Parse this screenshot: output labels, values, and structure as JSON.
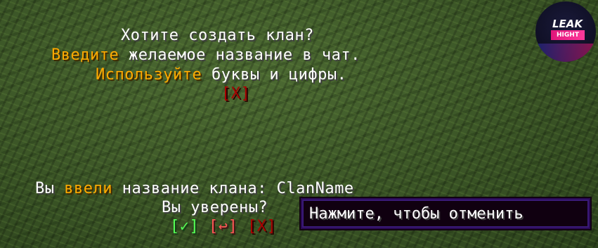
{
  "prompt_block": {
    "line1": "Хотите создать клан?",
    "line2": {
      "highlight": "Введите",
      "rest": " желаемое название в чат."
    },
    "line3": {
      "highlight": "Используйте",
      "rest": " буквы и цифры."
    },
    "cancel": "[X]"
  },
  "confirm_block": {
    "line1": {
      "pre": "Вы ",
      "highlight": "ввели",
      "rest": " название клана: ClanName"
    },
    "line2": "Вы уверены?",
    "buttons": {
      "confirm": "[✓]",
      "retry": "[↩]",
      "cancel": "[X]"
    }
  },
  "tooltip": {
    "text": "Нажмите, чтобы отменить"
  },
  "logo": {
    "top": "LEAK",
    "bottom": "HIGHT"
  },
  "colors": {
    "gold": "#ffaa00",
    "green": "#55ff55",
    "red": "#ff5555",
    "dark_red": "#aa0000",
    "white": "#ffffff"
  }
}
